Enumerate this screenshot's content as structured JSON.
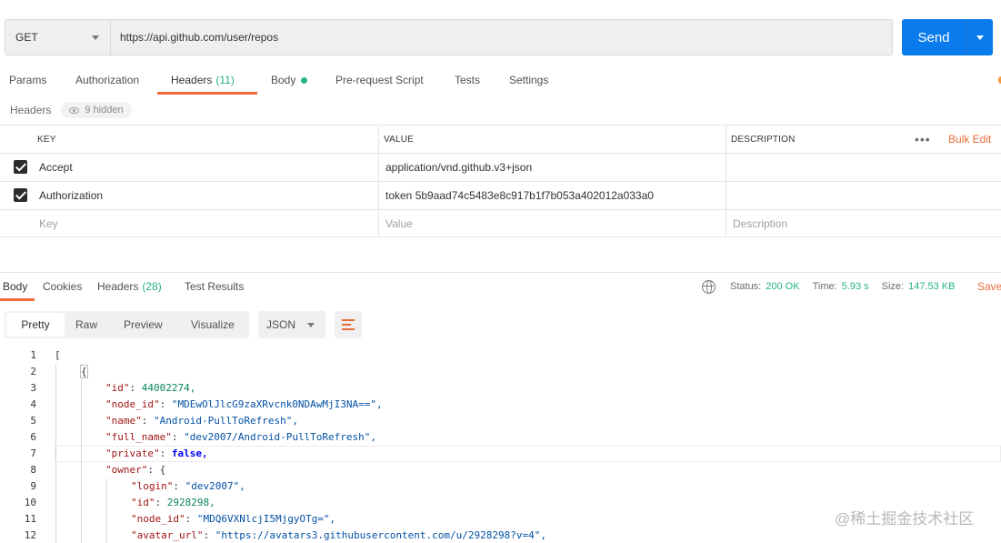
{
  "request": {
    "method": "GET",
    "url": "https://api.github.com/user/repos",
    "send_label": "Send"
  },
  "tabs": [
    {
      "label": "Params"
    },
    {
      "label": "Authorization"
    },
    {
      "label": "Headers",
      "count": "(11)"
    },
    {
      "label": "Body"
    },
    {
      "label": "Pre-request Script"
    },
    {
      "label": "Tests"
    },
    {
      "label": "Settings"
    }
  ],
  "headers_section": {
    "label": "Headers",
    "hidden": "9 hidden"
  },
  "headers_table": {
    "columns": [
      "KEY",
      "VALUE",
      "DESCRIPTION"
    ],
    "bulk_edit": "Bulk Edit",
    "more": "•••",
    "rows": [
      {
        "key": "Accept",
        "value": "application/vnd.github.v3+json",
        "description": ""
      },
      {
        "key": "Authorization",
        "value": "token 5b9aad74c5483e8c917b1f7b053a402012a033a0",
        "description": ""
      }
    ],
    "placeholders": {
      "key": "Key",
      "value": "Value",
      "description": "Description"
    }
  },
  "response": {
    "tabs": [
      {
        "label": "Body"
      },
      {
        "label": "Cookies"
      },
      {
        "label": "Headers",
        "count": "(28)"
      },
      {
        "label": "Test Results"
      }
    ],
    "status_label": "Status:",
    "status_value": "200 OK",
    "time_label": "Time:",
    "time_value": "5.93 s",
    "size_label": "Size:",
    "size_value": "147.53 KB",
    "save": "Save"
  },
  "view": {
    "modes": [
      "Pretty",
      "Raw",
      "Preview",
      "Visualize"
    ],
    "format": "JSON"
  },
  "code": {
    "line_numbers": [
      "1",
      "2",
      "3",
      "4",
      "5",
      "6",
      "7",
      "8",
      "9",
      "10",
      "11",
      "12"
    ],
    "lines": [
      "[",
      "{",
      "\"id\": 44002274,",
      "\"node_id\": \"MDEwOlJlcG9zaXRvcnk0NDAwMjI3NA==\",",
      "\"name\": \"Android-PullToRefresh\",",
      "\"full_name\": \"dev2007/Android-PullToRefresh\",",
      "\"private\": false,",
      "\"owner\": {",
      "\"login\": \"dev2007\",",
      "\"id\": 2928298,",
      "\"node_id\": \"MDQ6VXNlcjI5MjgyOTg=\",",
      "\"avatar_url\": \"https://avatars3.githubusercontent.com/u/2928298?v=4\","
    ]
  },
  "watermark": "@稀土掘金技术社区",
  "colors": {
    "accent": "#f26b3a",
    "send": "#097bed",
    "success": "#26b47f"
  }
}
